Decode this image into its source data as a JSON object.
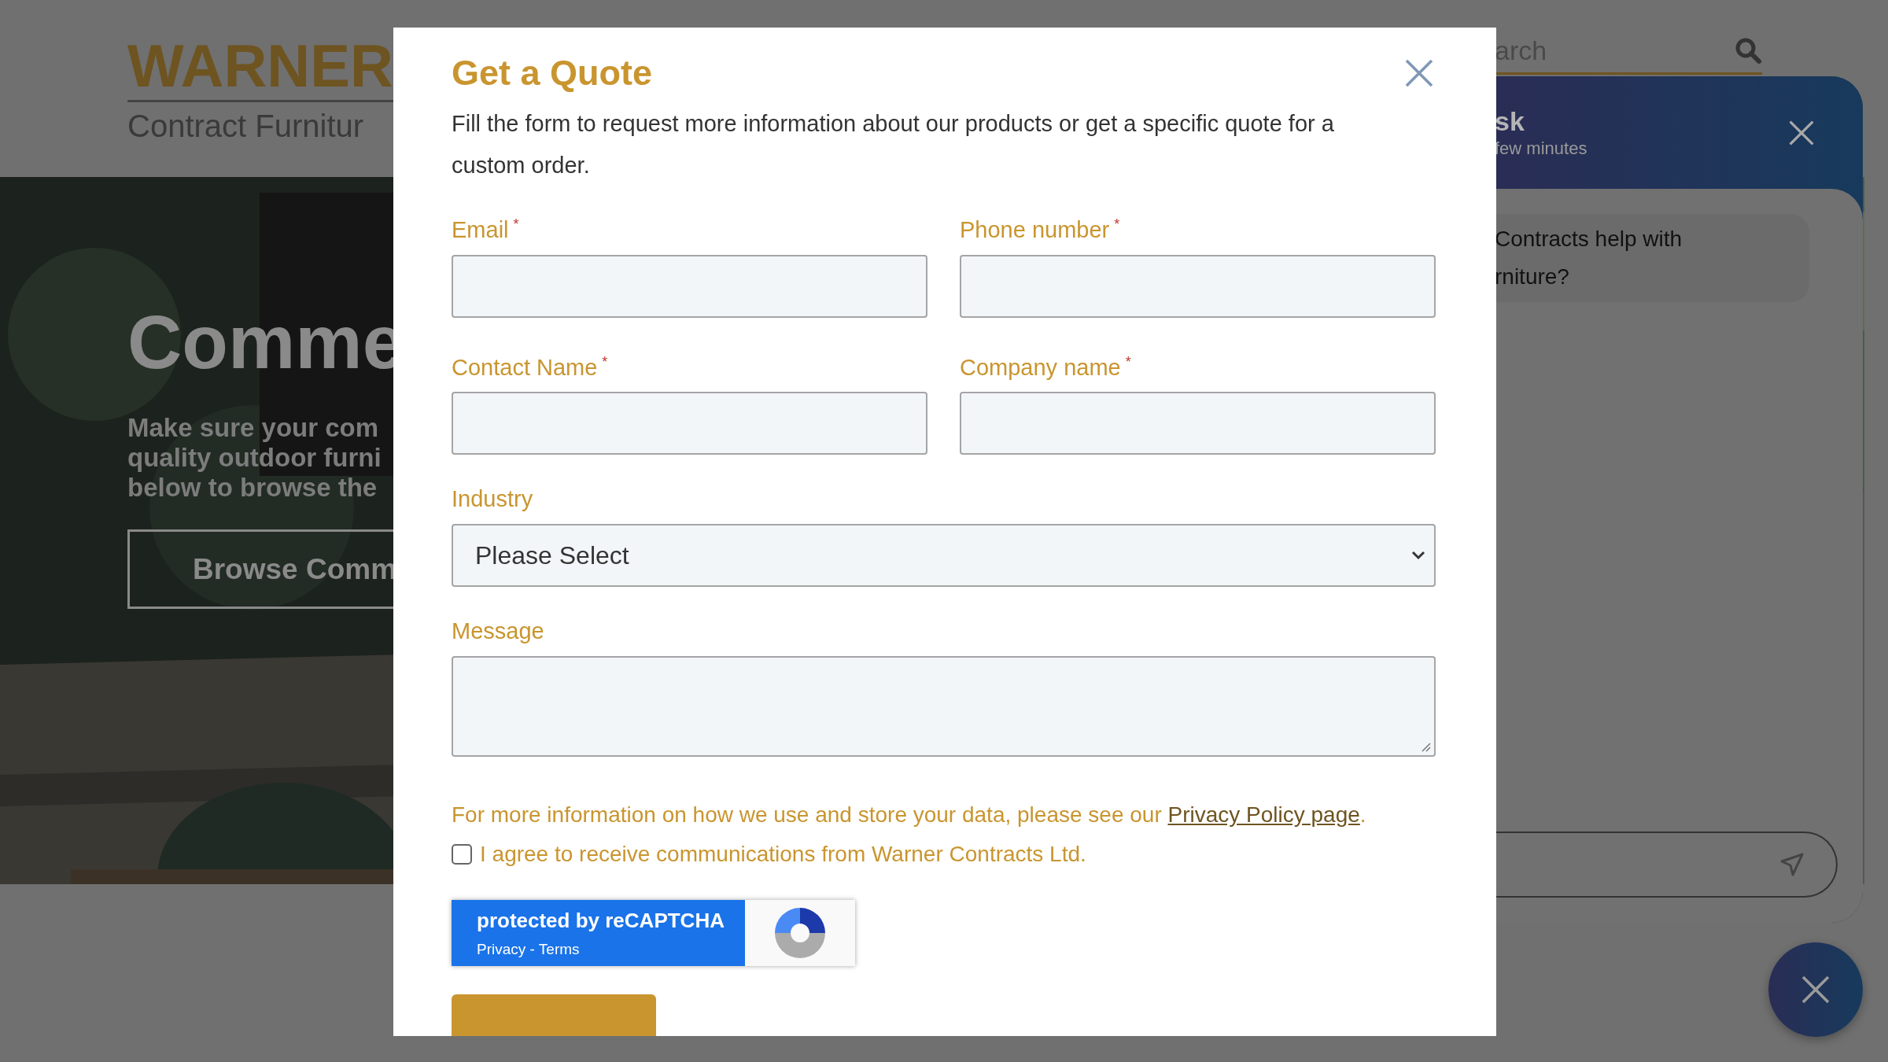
{
  "site_header": {
    "logo_word": "WARNER",
    "logo_tagline": "Contract Furnitur",
    "search": {
      "placeholder": "arch"
    }
  },
  "hero": {
    "title": "Comme",
    "lines": [
      "Make sure your com",
      "quality outdoor furni",
      "below to browse the"
    ],
    "button": "Browse Comm"
  },
  "chat": {
    "title": "sk",
    "subtitle": "few minutes",
    "message_lines": [
      "Contracts help with",
      "rniture?"
    ]
  },
  "modal": {
    "title": "Get a Quote",
    "description": "Fill the form to request more information about our products or get a specific quote for a custom order.",
    "fields": [
      {
        "label": "Email",
        "mark": "*",
        "kind": "input"
      },
      {
        "label": "Phone number",
        "mark": "*",
        "kind": "input"
      },
      {
        "label": "Contact Name",
        "mark": "*",
        "kind": "input"
      },
      {
        "label": "Company name",
        "mark": "*",
        "kind": "input"
      },
      {
        "label": "Industry",
        "kind": "select",
        "value": "Please Select"
      },
      {
        "label": "Message",
        "kind": "textarea"
      }
    ],
    "privacy_note": "For more information on how we use and store your data, please see our ",
    "privacy_link": "Privacy Policy page",
    "privacy_end": ".",
    "consent": {
      "label": "I agree to receive communications from Warner Contracts Ltd.",
      "checked": false
    },
    "recaptcha": {
      "title": "protected by reCAPTCHA",
      "links": "Privacy - Terms"
    }
  }
}
